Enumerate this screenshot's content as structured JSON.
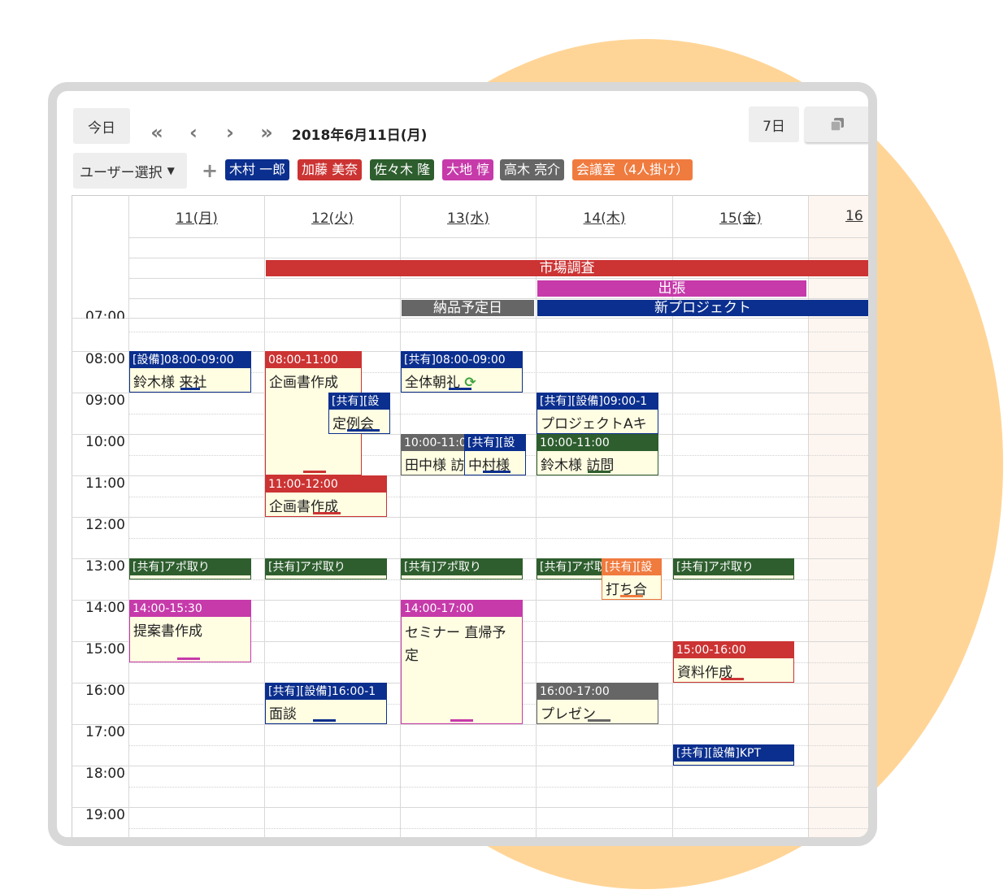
{
  "toolbar": {
    "today": "今日",
    "date_title": "2018年6月11日(月)",
    "range": "7日",
    "first_icon": "«",
    "prev_icon": "‹",
    "next_icon": "›",
    "last_icon": "»"
  },
  "users": {
    "select_label": "ユーザー選択",
    "add": "+",
    "tags": [
      {
        "label": "木村 一郎",
        "color": "#0B2F8E"
      },
      {
        "label": "加藤 美奈",
        "color": "#CC3333"
      },
      {
        "label": "佐々木 隆",
        "color": "#2E5E2E"
      },
      {
        "label": "大地 惇",
        "color": "#C63AAA"
      },
      {
        "label": "高木 亮介",
        "color": "#666666"
      },
      {
        "label": "会議室（4人掛け）",
        "color": "#F07B3F"
      }
    ]
  },
  "days": [
    "11(月)",
    "12(火)",
    "13(水)",
    "14(木)",
    "15(金)",
    "16"
  ],
  "times": [
    "07:00",
    "08:00",
    "09:00",
    "10:00",
    "11:00",
    "12:00",
    "13:00",
    "14:00",
    "15:00",
    "16:00",
    "17:00",
    "18:00",
    "19:00"
  ],
  "allday": {
    "market": "市場調査",
    "trip": "出張",
    "delivery": "納品予定日",
    "project": "新プロジェクト"
  },
  "events": {
    "e1_head": "[設備]08:00-09:00",
    "e1_body": "鈴木様 来社",
    "e2_head": "08:00-11:00",
    "e2_body": "企画書作成",
    "e3_head": "[共有][設",
    "e3_body": "定例会",
    "e4_head": "11:00-12:00",
    "e4_body": "企画書作成",
    "e5_head": "[共有]08:00-09:00",
    "e5_body": "全体朝礼",
    "e6_head": "10:00-11:0",
    "e6_body": "田中様 訪",
    "e7_head": "[共有][設",
    "e7_body": "中村様",
    "e8_head": "[共有][設備]09:00-1",
    "e8_body": "プロジェクトAキ",
    "e9_head": "10:00-11:00",
    "e9_body": "鈴木様 訪問",
    "apo": "[共有]アポ取り",
    "apo_short": "[共有]アポ取",
    "e10_head": "[共有][設",
    "e10_body": "打ち合",
    "e11_head": "14:00-15:30",
    "e11_body": "提案書作成",
    "e12_head": "14:00-17:00",
    "e12_body": "セミナー 直帰予定",
    "e13_head": "15:00-16:00",
    "e13_body": "資料作成",
    "e14_head": "[共有][設備]16:00-1",
    "e14_body": "面談",
    "e15_head": "16:00-17:00",
    "e15_body": "プレゼン",
    "e16_head": "[共有][設備]KPT"
  },
  "colors": {
    "blue": "#0B2F8E",
    "red": "#CC3333",
    "green": "#2E5E2E",
    "magenta": "#C63AAA",
    "gray": "#666666",
    "orange": "#F07B3F",
    "event_bg": "#FFFDE2",
    "saturday_bg": "#FDF5EF",
    "decor": "#FFD597"
  },
  "icons": [
    "first-page-icon",
    "prev-icon",
    "next-icon",
    "last-page-icon",
    "add-icon",
    "chevron-down-icon",
    "copy-icon",
    "repeat-icon"
  ]
}
